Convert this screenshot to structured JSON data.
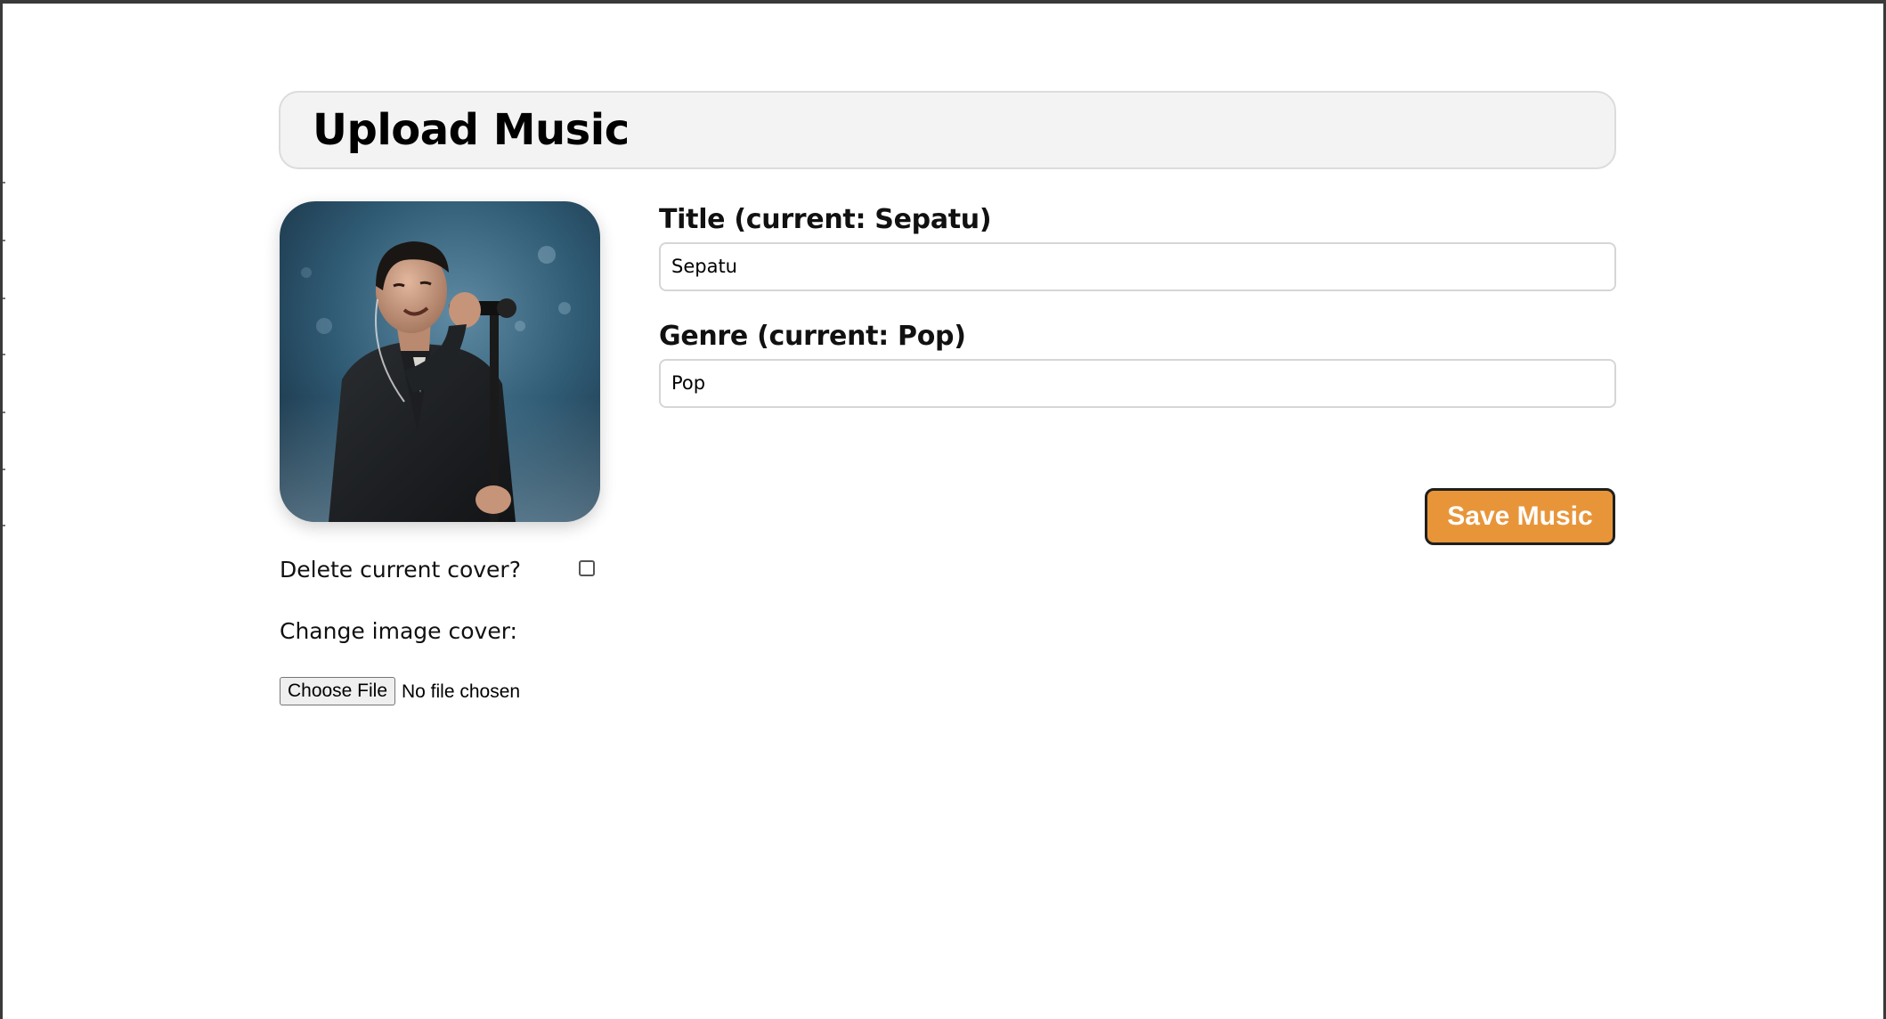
{
  "header": {
    "title": "Upload Music"
  },
  "cover": {
    "alt": "Current cover image: singer performing with microphone on stage"
  },
  "cover_options": {
    "delete_label": "Delete current cover?",
    "delete_checked": false,
    "change_label": "Change image cover:",
    "choose_file_label": "Choose File",
    "file_status": "No file chosen"
  },
  "form": {
    "title_label": "Title (current: Sepatu)",
    "title_value": "Sepatu",
    "genre_label": "Genre (current: Pop)",
    "genre_value": "Pop",
    "save_label": "Save Music"
  },
  "colors": {
    "accent": "#e8953a",
    "header_bg": "#f3f3f3"
  }
}
